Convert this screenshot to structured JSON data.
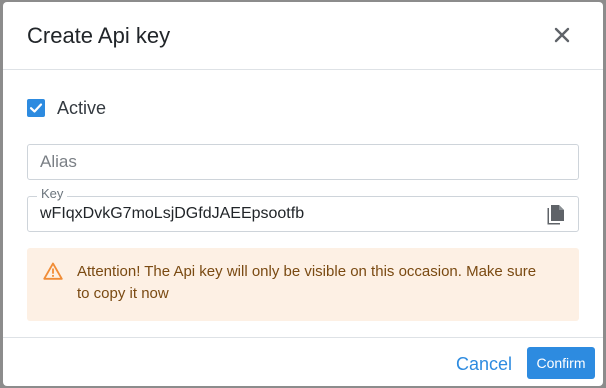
{
  "dialog": {
    "title": "Create Api key"
  },
  "form": {
    "active_label": "Active",
    "active_checked": true,
    "alias_placeholder": "Alias",
    "alias_value": "",
    "key_label": "Key",
    "key_value": "wFIqxDvkG7moLsjDGfdJAEEpsootfb"
  },
  "warning": {
    "text": "Attention! The Api key will only be visible on this occasion. Make sure to copy it now"
  },
  "footer": {
    "cancel_label": "Cancel",
    "confirm_label": "Confirm"
  },
  "icons": {
    "close": "close-icon",
    "checkbox": "check-icon",
    "copy": "copy-icon",
    "warning": "warning-triangle-icon"
  },
  "colors": {
    "accent": "#2d8be0",
    "warning_bg": "#fdf0e4",
    "warning_icon": "#f08c36"
  }
}
